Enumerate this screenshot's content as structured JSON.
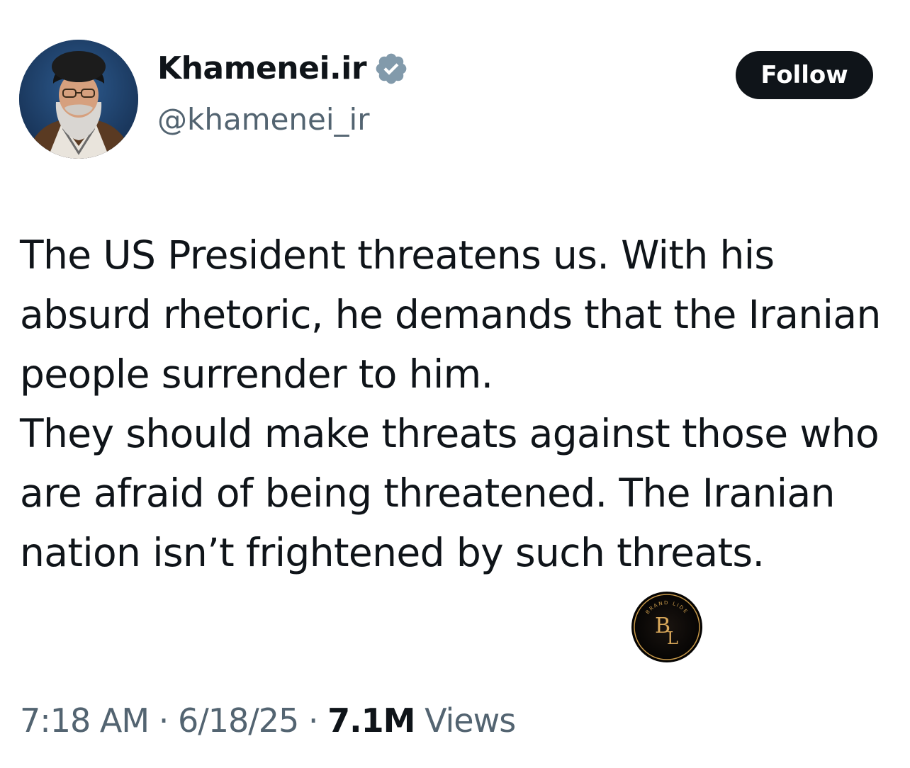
{
  "header": {
    "display_name": "Khamenei.ir",
    "handle": "@khamenei_ir",
    "verified_icon": "verified-badge-icon",
    "follow_label": "Follow"
  },
  "tweet": {
    "paragraphs": [
      "The US President threatens us. With his absurd rhetoric, he demands that the Iranian people surrender to him.",
      "They should make threats against those who are afraid of being threatened. The Iranian nation isn’t frightened by such threats."
    ]
  },
  "watermark": {
    "text": "BRAND LIDE",
    "monogram_top": "B",
    "monogram_bottom": "L"
  },
  "meta": {
    "time": "7:18 AM",
    "separator": "·",
    "date": "6/18/25",
    "views_count": "7.1M",
    "views_label": "Views"
  },
  "colors": {
    "text": "#0f1419",
    "secondary": "#536471",
    "button_bg": "#0f1419",
    "verified": "#829aab"
  }
}
